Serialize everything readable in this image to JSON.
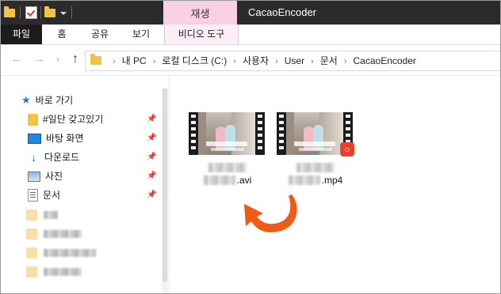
{
  "title_bar": {
    "context_tab_label": "재생",
    "window_title": "CacaoEncoder"
  },
  "ribbon": {
    "tabs": [
      {
        "label": "파일"
      },
      {
        "label": "홈"
      },
      {
        "label": "공유"
      },
      {
        "label": "보기"
      },
      {
        "label": "비디오 도구"
      }
    ]
  },
  "address": {
    "crumbs": [
      "내 PC",
      "로컬 디스크 (C:)",
      "사용자",
      "User",
      "문서",
      "CacaoEncoder"
    ]
  },
  "sidebar": {
    "quick_access_label": "바로 가기",
    "items": [
      {
        "label": "#일단 갖고있기",
        "icon": "folder-icon"
      },
      {
        "label": "바탕 화면",
        "icon": "desktop-icon"
      },
      {
        "label": "다운로드",
        "icon": "download-icon"
      },
      {
        "label": "사진",
        "icon": "pictures-icon"
      },
      {
        "label": "문서",
        "icon": "documents-icon"
      }
    ]
  },
  "files": [
    {
      "extension": ".avi",
      "app_icon": "none"
    },
    {
      "extension": ".mp4",
      "app_icon": "gom-player-icon"
    }
  ],
  "colors": {
    "context_tab": "#f9d1e4",
    "file_tab": "#1c1c1c",
    "title_bar": "#2b2b2b",
    "arrow": "#f05a14"
  }
}
